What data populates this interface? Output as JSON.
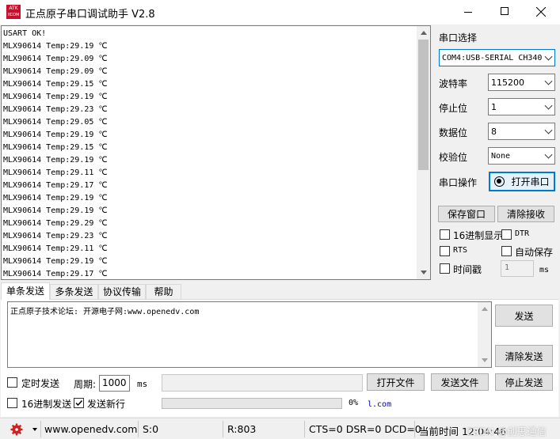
{
  "titlebar": {
    "logo_top": "ATK",
    "logo_bottom": "XCOM",
    "title": "正点原子串口调试助手 V2.8"
  },
  "receive": {
    "lines": [
      "USART OK!",
      "MLX90614 Temp:29.19 ℃",
      "MLX90614 Temp:29.09 ℃",
      "MLX90614 Temp:29.09 ℃",
      "MLX90614 Temp:29.15 ℃",
      "MLX90614 Temp:29.19 ℃",
      "MLX90614 Temp:29.23 ℃",
      "MLX90614 Temp:29.05 ℃",
      "MLX90614 Temp:29.19 ℃",
      "MLX90614 Temp:29.15 ℃",
      "MLX90614 Temp:29.19 ℃",
      "MLX90614 Temp:29.11 ℃",
      "MLX90614 Temp:29.17 ℃",
      "MLX90614 Temp:29.19 ℃",
      "MLX90614 Temp:29.19 ℃",
      "MLX90614 Temp:29.29 ℃",
      "MLX90614 Temp:29.23 ℃",
      "MLX90614 Temp:29.11 ℃",
      "MLX90614 Temp:29.19 ℃",
      "MLX90614 Temp:29.17 ℃"
    ]
  },
  "settings": {
    "port_select_label": "串口选择",
    "port_value": "COM4:USB-SERIAL CH340",
    "baud_label": "波特率",
    "baud_value": "115200",
    "stop_label": "停止位",
    "stop_value": "1",
    "data_label": "数据位",
    "data_value": "8",
    "parity_label": "校验位",
    "parity_value": "None",
    "op_label": "串口操作",
    "open_port_label": "打开串口",
    "save_window_label": "保存窗口",
    "clear_receive_label": "清除接收",
    "hex_display_label": "16进制显示",
    "dtr_label": "DTR",
    "rts_label": "RTS",
    "auto_save_label": "自动保存",
    "timestamp_label": "时间戳",
    "timestamp_value": "1",
    "timestamp_unit": "ms"
  },
  "tabs": [
    "单条发送",
    "多条发送",
    "协议传输",
    "帮助"
  ],
  "send": {
    "text": "正点原子技术论坛: 开源电子网:www.openedv.com",
    "send_label": "发送",
    "clear_send_label": "清除发送",
    "timed_send_label": "定时发送",
    "period_label": "周期:",
    "period_value": "1000",
    "period_unit": "ms",
    "open_file_label": "打开文件",
    "send_file_label": "发送文件",
    "stop_send_label": "停止发送",
    "hex_send_label": "16进制发送",
    "newline_label": "发送新行",
    "progress_text": "0%",
    "progress": 0,
    "url_text": "l.com"
  },
  "statusbar": {
    "url": "www.openedv.com",
    "s": "S:0",
    "r": "R:803",
    "signals": "CTS=0 DSR=0 DCD=0",
    "time": "当前时间 12:04:46",
    "watermark": "CSDN @创思通信"
  },
  "colors": {
    "accent": "#0078d7",
    "logo_red": "#c8102e"
  }
}
